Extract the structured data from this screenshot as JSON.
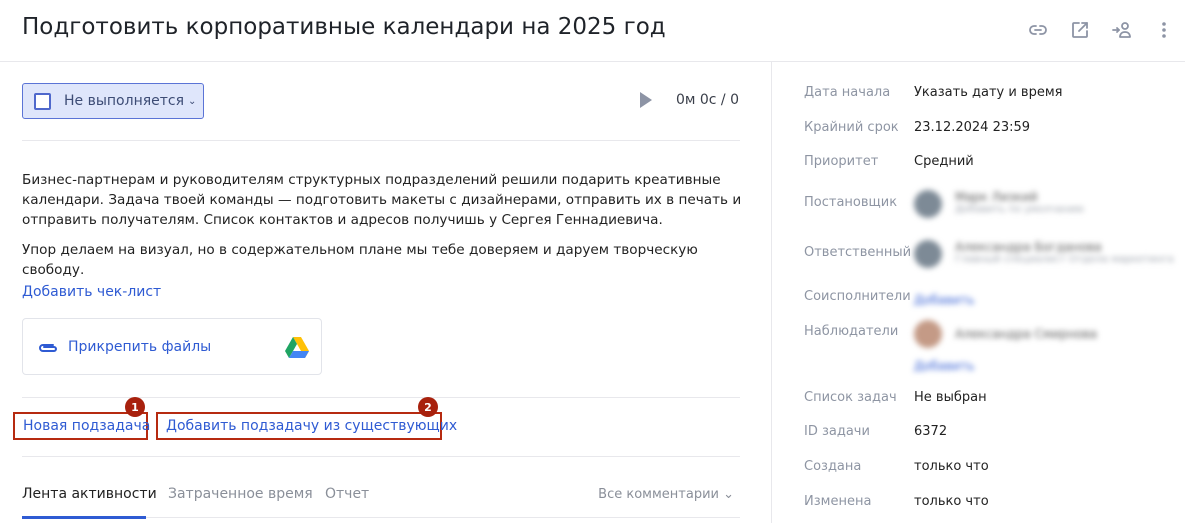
{
  "header": {
    "title": "Подготовить корпоративные календари на 2025 год",
    "icons": [
      "link-icon",
      "open-external-icon",
      "delegate-user-icon",
      "more-vertical-icon"
    ]
  },
  "status": {
    "label": "Не выполняется",
    "chevron": "⌄"
  },
  "timer": {
    "text": "0м 0с / 0"
  },
  "description": {
    "paragraph1": "Бизнес-партнерам и руководителям структурных подразделений решили подарить креативные календари. Задача твоей команды — подготовить макеты с дизайнерами, отправить их в печать и отправить получателям. Список контактов и адресов получишь у Сергея Геннадиевича.",
    "paragraph2": "Упор делаем на визуал, но в содержательном плане мы тебе доверяем и даруем творческую свободу."
  },
  "checklist": {
    "label": "Добавить чек-лист"
  },
  "attach": {
    "label": "Прикрепить файлы"
  },
  "subtasks": {
    "new_label": "Новая подзадача",
    "add_existing_label": "Добавить подзадачу из существующих",
    "badge1": "1",
    "badge2": "2"
  },
  "tabs": {
    "activity": "Лента активности",
    "time_spent": "Затраченное время",
    "report": "Отчет",
    "comments_filter": "Все комментарии ⌄"
  },
  "properties": {
    "start_label": "Дата начала",
    "start_value": "Указать дату и время",
    "deadline_label": "Крайний срок",
    "deadline_value": "23.12.2024  23:59",
    "priority_label": "Приоритет",
    "priority_value": "Средний",
    "author_label": "Постановщик",
    "author_name": "Марк Лизкий",
    "author_role": "Добавить по умолчанию",
    "assignee_label": "Ответственный",
    "assignee_name": "Александра Богданова",
    "assignee_role": "Главный специалист Отдела маркетинга",
    "coexecutors_label": "Соисполнители",
    "coexecutors_link": "Добавить",
    "observers_label": "Наблюдатели",
    "observer_name": "Александра Смирнова",
    "observers_link": "Добавить",
    "tasklist_label": "Список задач",
    "tasklist_value": "Не выбран",
    "id_label": "ID задачи",
    "id_value": "6372",
    "created_label": "Создана",
    "created_value": "только что",
    "changed_label": "Изменена",
    "changed_value": "только что"
  },
  "colors": {
    "accent": "#2f5bd3",
    "status_bg": "#dfe6fb",
    "highlight_border": "#b62a10",
    "badge": "#a8210d"
  }
}
